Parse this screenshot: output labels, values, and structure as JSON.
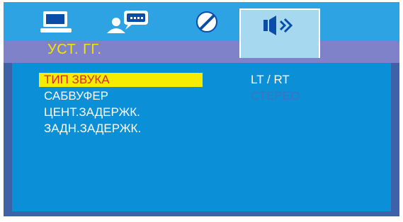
{
  "tabs": [
    {
      "icon": "monitor-icon",
      "active": false
    },
    {
      "icon": "user-speech-icon",
      "active": false
    },
    {
      "icon": "disc-icon",
      "active": false
    },
    {
      "icon": "speaker-icon",
      "active": true
    }
  ],
  "title": "УСТ. ГГ.",
  "menu": {
    "items": [
      "ТИП ЗВУКА",
      "САБВУФЕР",
      "ЦЕНТ.ЗАДЕРЖК.",
      "ЗАДН.ЗАДЕРЖК."
    ],
    "selected_index": 0
  },
  "values": {
    "current": "LT / RT",
    "option": "СТЕРЕО"
  },
  "colors": {
    "tab_bar": "#2da3e3",
    "active_tab": "#a6d8f0",
    "title_bar": "#7f82c9",
    "title_text": "#f3e600",
    "panel": "#0b8fd6",
    "panel_border": "#3e62a8",
    "highlight": "#f6ec00",
    "highlight_text": "#e0252a",
    "option_text": "#3f72bf"
  }
}
